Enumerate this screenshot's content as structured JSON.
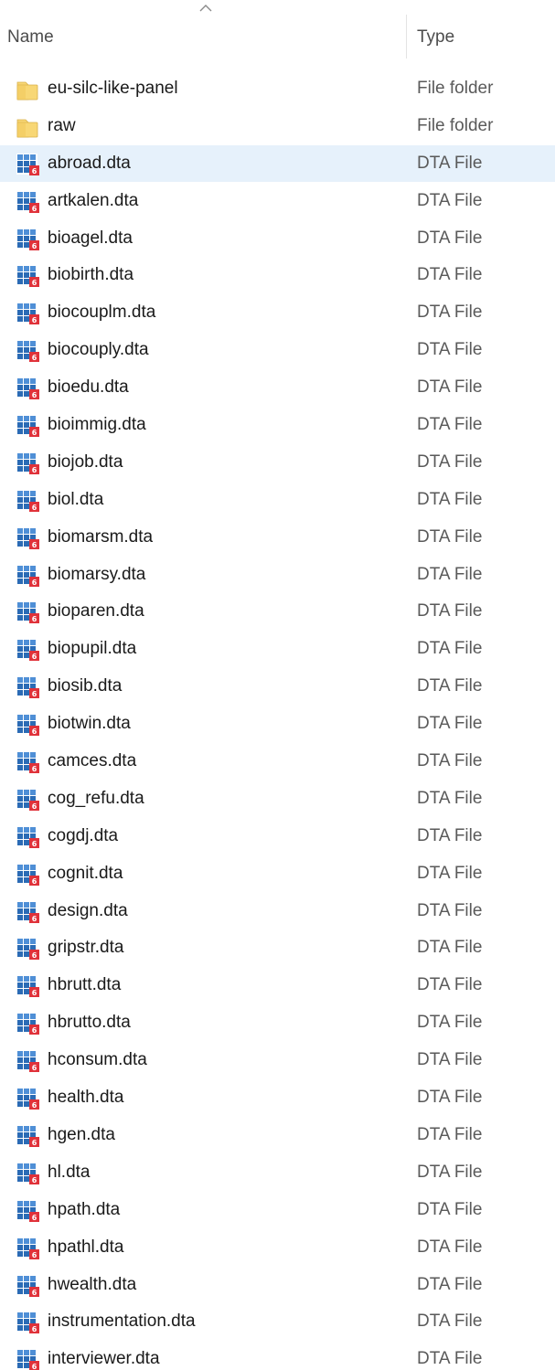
{
  "columns": {
    "name": "Name",
    "type": "Type"
  },
  "selected_index": 2,
  "icons": {
    "folder": "folder-icon",
    "dta": "dta-file-icon"
  },
  "colors": {
    "folder": "#f8d775",
    "dta_grid": "#2b6bb5",
    "dta_badge": "#e0323a",
    "selection": "#e6f1fb"
  },
  "files": [
    {
      "name": "eu-silc-like-panel",
      "type": "File folder",
      "kind": "folder"
    },
    {
      "name": "raw",
      "type": "File folder",
      "kind": "folder"
    },
    {
      "name": "abroad.dta",
      "type": "DTA File",
      "kind": "dta"
    },
    {
      "name": "artkalen.dta",
      "type": "DTA File",
      "kind": "dta"
    },
    {
      "name": "bioagel.dta",
      "type": "DTA File",
      "kind": "dta"
    },
    {
      "name": "biobirth.dta",
      "type": "DTA File",
      "kind": "dta"
    },
    {
      "name": "biocouplm.dta",
      "type": "DTA File",
      "kind": "dta"
    },
    {
      "name": "biocouply.dta",
      "type": "DTA File",
      "kind": "dta"
    },
    {
      "name": "bioedu.dta",
      "type": "DTA File",
      "kind": "dta"
    },
    {
      "name": "bioimmig.dta",
      "type": "DTA File",
      "kind": "dta"
    },
    {
      "name": "biojob.dta",
      "type": "DTA File",
      "kind": "dta"
    },
    {
      "name": "biol.dta",
      "type": "DTA File",
      "kind": "dta"
    },
    {
      "name": "biomarsm.dta",
      "type": "DTA File",
      "kind": "dta"
    },
    {
      "name": "biomarsy.dta",
      "type": "DTA File",
      "kind": "dta"
    },
    {
      "name": "bioparen.dta",
      "type": "DTA File",
      "kind": "dta"
    },
    {
      "name": "biopupil.dta",
      "type": "DTA File",
      "kind": "dta"
    },
    {
      "name": "biosib.dta",
      "type": "DTA File",
      "kind": "dta"
    },
    {
      "name": "biotwin.dta",
      "type": "DTA File",
      "kind": "dta"
    },
    {
      "name": "camces.dta",
      "type": "DTA File",
      "kind": "dta"
    },
    {
      "name": "cog_refu.dta",
      "type": "DTA File",
      "kind": "dta"
    },
    {
      "name": "cogdj.dta",
      "type": "DTA File",
      "kind": "dta"
    },
    {
      "name": "cognit.dta",
      "type": "DTA File",
      "kind": "dta"
    },
    {
      "name": "design.dta",
      "type": "DTA File",
      "kind": "dta"
    },
    {
      "name": "gripstr.dta",
      "type": "DTA File",
      "kind": "dta"
    },
    {
      "name": "hbrutt.dta",
      "type": "DTA File",
      "kind": "dta"
    },
    {
      "name": "hbrutto.dta",
      "type": "DTA File",
      "kind": "dta"
    },
    {
      "name": "hconsum.dta",
      "type": "DTA File",
      "kind": "dta"
    },
    {
      "name": "health.dta",
      "type": "DTA File",
      "kind": "dta"
    },
    {
      "name": "hgen.dta",
      "type": "DTA File",
      "kind": "dta"
    },
    {
      "name": "hl.dta",
      "type": "DTA File",
      "kind": "dta"
    },
    {
      "name": "hpath.dta",
      "type": "DTA File",
      "kind": "dta"
    },
    {
      "name": "hpathl.dta",
      "type": "DTA File",
      "kind": "dta"
    },
    {
      "name": "hwealth.dta",
      "type": "DTA File",
      "kind": "dta"
    },
    {
      "name": "instrumentation.dta",
      "type": "DTA File",
      "kind": "dta"
    },
    {
      "name": "interviewer.dta",
      "type": "DTA File",
      "kind": "dta"
    }
  ]
}
